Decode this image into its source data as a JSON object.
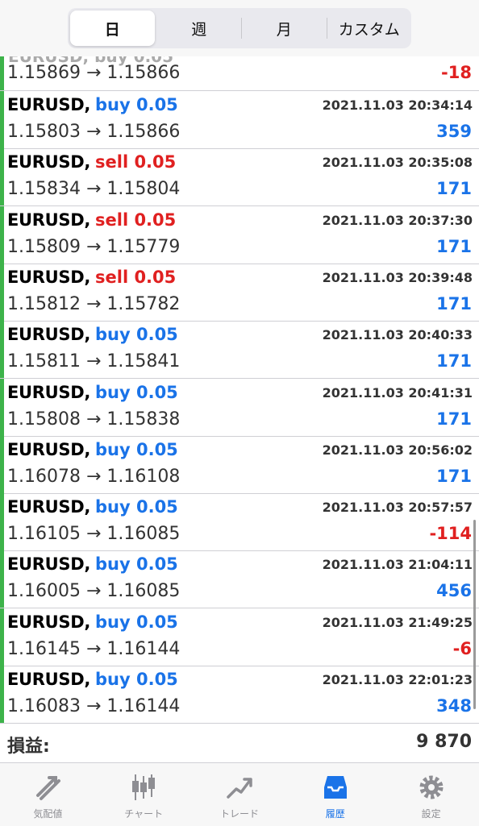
{
  "segments": {
    "day": "日",
    "week": "週",
    "month": "月",
    "custom": "カスタム"
  },
  "partial": {
    "prices": "1.15869 → 1.15866",
    "profit": "-18"
  },
  "trades": [
    {
      "symbol": "EURUSD,",
      "side": "buy 0.05",
      "type": "buy",
      "time": "2021.11.03 20:34:14",
      "prices": "1.15803 → 1.15866",
      "profit": "359",
      "pl": "pos"
    },
    {
      "symbol": "EURUSD,",
      "side": "sell 0.05",
      "type": "sell",
      "time": "2021.11.03 20:35:08",
      "prices": "1.15834 → 1.15804",
      "profit": "171",
      "pl": "pos"
    },
    {
      "symbol": "EURUSD,",
      "side": "sell 0.05",
      "type": "sell",
      "time": "2021.11.03 20:37:30",
      "prices": "1.15809 → 1.15779",
      "profit": "171",
      "pl": "pos"
    },
    {
      "symbol": "EURUSD,",
      "side": "sell 0.05",
      "type": "sell",
      "time": "2021.11.03 20:39:48",
      "prices": "1.15812 → 1.15782",
      "profit": "171",
      "pl": "pos"
    },
    {
      "symbol": "EURUSD,",
      "side": "buy 0.05",
      "type": "buy",
      "time": "2021.11.03 20:40:33",
      "prices": "1.15811 → 1.15841",
      "profit": "171",
      "pl": "pos"
    },
    {
      "symbol": "EURUSD,",
      "side": "buy 0.05",
      "type": "buy",
      "time": "2021.11.03 20:41:31",
      "prices": "1.15808 → 1.15838",
      "profit": "171",
      "pl": "pos"
    },
    {
      "symbol": "EURUSD,",
      "side": "buy 0.05",
      "type": "buy",
      "time": "2021.11.03 20:56:02",
      "prices": "1.16078 → 1.16108",
      "profit": "171",
      "pl": "pos"
    },
    {
      "symbol": "EURUSD,",
      "side": "buy 0.05",
      "type": "buy",
      "time": "2021.11.03 20:57:57",
      "prices": "1.16105 → 1.16085",
      "profit": "-114",
      "pl": "neg"
    },
    {
      "symbol": "EURUSD,",
      "side": "buy 0.05",
      "type": "buy",
      "time": "2021.11.03 21:04:11",
      "prices": "1.16005 → 1.16085",
      "profit": "456",
      "pl": "pos"
    },
    {
      "symbol": "EURUSD,",
      "side": "buy 0.05",
      "type": "buy",
      "time": "2021.11.03 21:49:25",
      "prices": "1.16145 → 1.16144",
      "profit": "-6",
      "pl": "neg"
    },
    {
      "symbol": "EURUSD,",
      "side": "buy 0.05",
      "type": "buy",
      "time": "2021.11.03 22:01:23",
      "prices": "1.16083 → 1.16144",
      "profit": "348",
      "pl": "pos"
    }
  ],
  "summary": {
    "label": "損益:",
    "value": "9 870"
  },
  "tabs": [
    {
      "label": "気配値",
      "icon": "quotes-icon"
    },
    {
      "label": "チャート",
      "icon": "chart-icon"
    },
    {
      "label": "トレード",
      "icon": "trade-icon"
    },
    {
      "label": "履歴",
      "icon": "history-icon"
    },
    {
      "label": "設定",
      "icon": "settings-icon"
    }
  ],
  "colors": {
    "buy": "#1a73e8",
    "sell": "#e02020",
    "accent": "#1a73e8",
    "bar": "#3db34a"
  }
}
